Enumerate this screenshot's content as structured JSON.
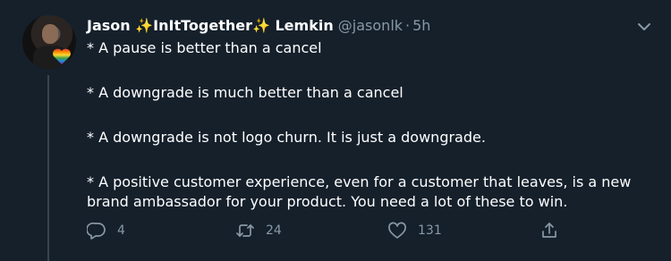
{
  "tweet": {
    "author_first": "Jason",
    "sparkle": "✨",
    "author_middle": "InItTogether",
    "author_last": "Lemkin",
    "handle": "@jasonlk",
    "separator": "·",
    "time": "5h",
    "lines": [
      "* A pause is better than a cancel",
      "* A downgrade is much better than a cancel",
      "* A downgrade is not logo churn.  It is just a downgrade.",
      "* A positive customer experience, even for a customer that leaves, is a new brand ambassador for your product. You need a lot of these to win."
    ]
  },
  "actions": {
    "reply_count": "4",
    "retweet_count": "24",
    "like_count": "131"
  },
  "icons": [
    "avatar",
    "chevron-down-icon",
    "reply-icon",
    "retweet-icon",
    "like-icon",
    "share-icon"
  ],
  "colors": {
    "background": "#15202b",
    "text": "#ffffff",
    "secondary": "#8899a6",
    "thread_line": "#38444d",
    "sparkle": "#ffcc4d"
  }
}
